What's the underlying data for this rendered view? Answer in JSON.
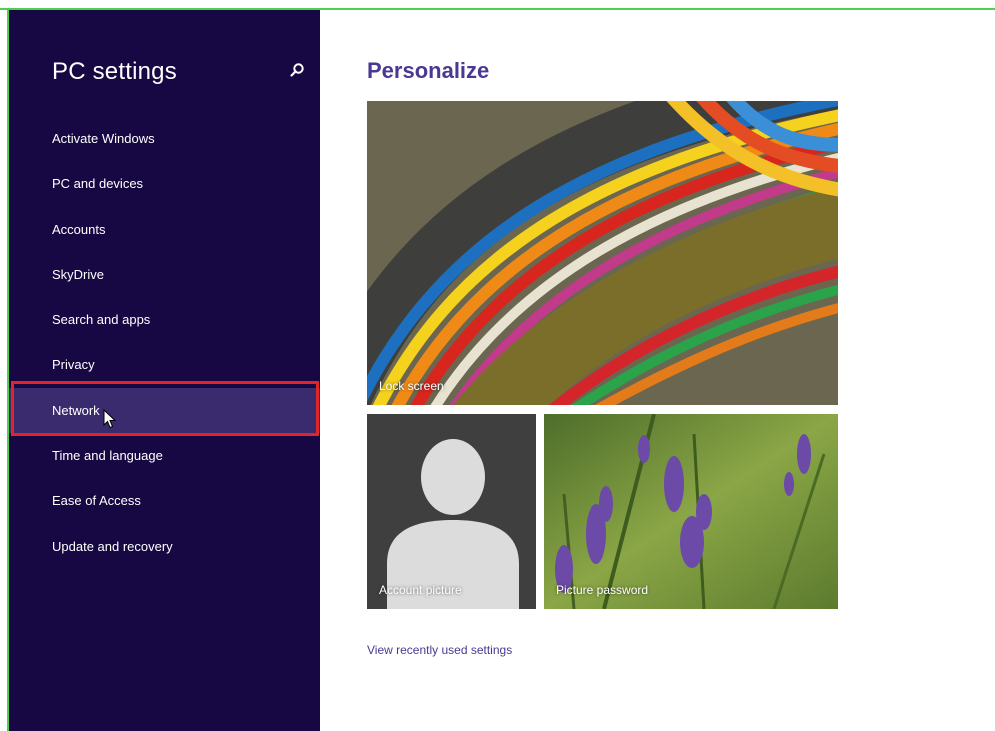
{
  "sidebar": {
    "title": "PC settings",
    "items": [
      {
        "label": "Activate Windows"
      },
      {
        "label": "PC and devices"
      },
      {
        "label": "Accounts"
      },
      {
        "label": "SkyDrive"
      },
      {
        "label": "Search and apps"
      },
      {
        "label": "Privacy"
      },
      {
        "label": "Network"
      },
      {
        "label": "Time and language"
      },
      {
        "label": "Ease of Access"
      },
      {
        "label": "Update and recovery"
      }
    ],
    "selected": "Network"
  },
  "main": {
    "title": "Personalize",
    "tiles": {
      "lock_screen": "Lock screen",
      "account_picture": "Account picture",
      "picture_password": "Picture password"
    },
    "recent_link": "View recently used settings"
  },
  "colors": {
    "sidebar_bg": "#170843",
    "selected_bg": "#3a2b6e",
    "accent": "#4b3893",
    "highlight_box": "#e2232a",
    "frame": "#4ed04e"
  },
  "icons": {
    "search": "search-icon",
    "cursor": "mouse-pointer-icon"
  }
}
